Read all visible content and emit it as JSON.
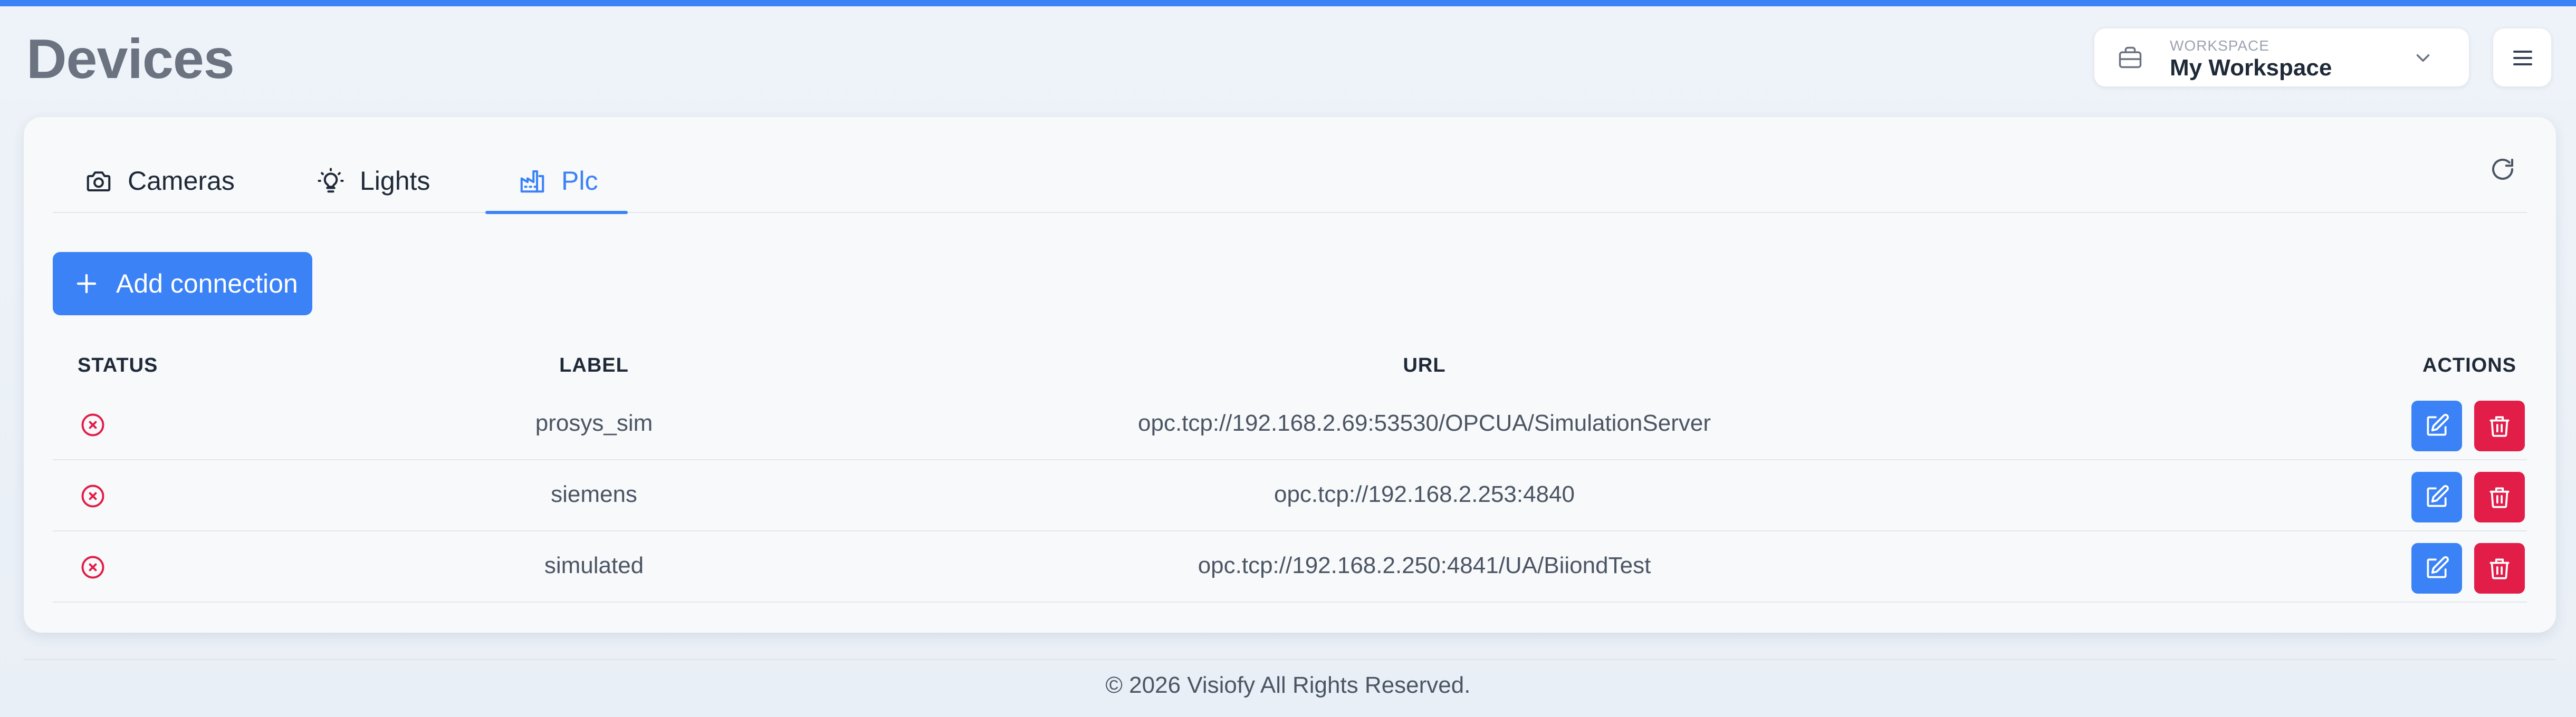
{
  "page": {
    "title": "Devices",
    "accent": "#3b82f6",
    "danger": "#e11d48"
  },
  "workspace": {
    "caption": "WORKSPACE",
    "name": "My Workspace",
    "icon": "briefcase-icon"
  },
  "tabs": [
    {
      "label": "Cameras",
      "icon": "camera-icon",
      "active": false
    },
    {
      "label": "Lights",
      "icon": "lightbulb-icon",
      "active": false
    },
    {
      "label": "Plc",
      "icon": "factory-icon",
      "active": true
    }
  ],
  "add_button": {
    "label": "Add connection",
    "icon": "plus-icon"
  },
  "table": {
    "columns": [
      "STATUS",
      "LABEL",
      "URL",
      "ACTIONS"
    ],
    "rows": [
      {
        "status": "error",
        "label": "prosys_sim",
        "url": "opc.tcp://192.168.2.69:53530/OPCUA/SimulationServer"
      },
      {
        "status": "error",
        "label": "siemens",
        "url": "opc.tcp://192.168.2.253:4840"
      },
      {
        "status": "error",
        "label": "simulated",
        "url": "opc.tcp://192.168.2.250:4841/UA/BiiondTest"
      }
    ]
  },
  "footer": {
    "text": "© 2026 Visiofy All Rights Reserved."
  }
}
